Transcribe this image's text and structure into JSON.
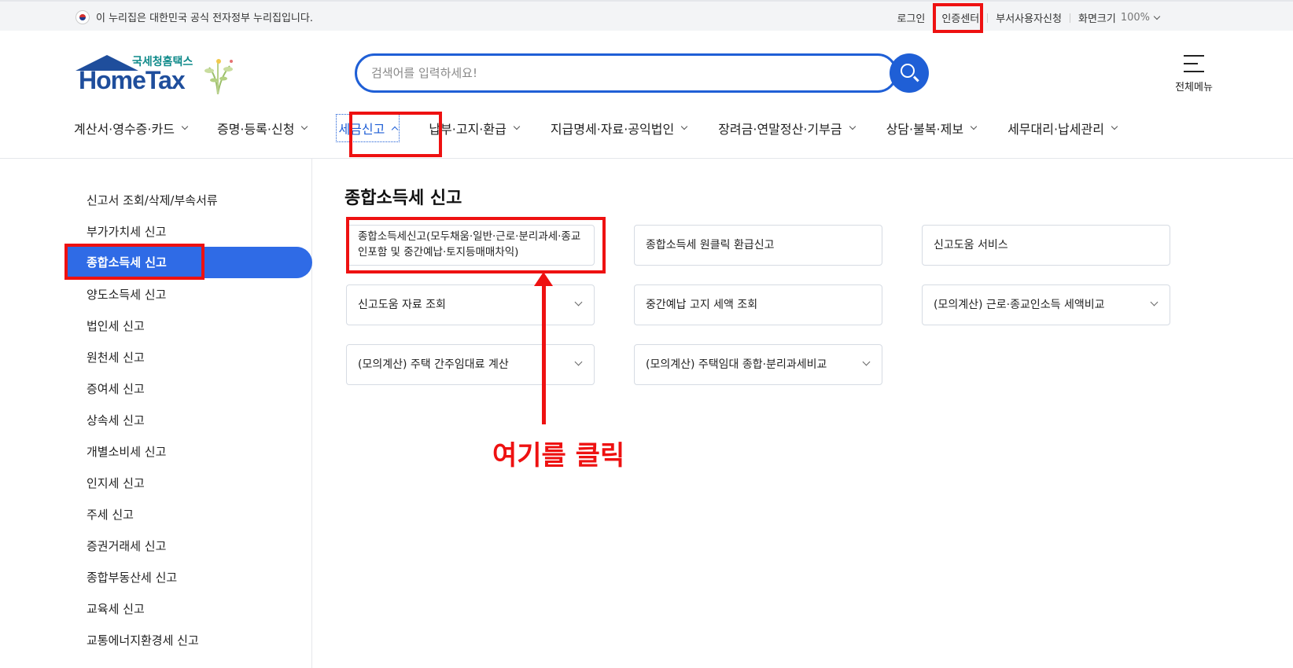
{
  "topbar": {
    "gov_notice": "이 누리집은 대한민국 공식 전자정부 누리집입니다.",
    "login": "로그인",
    "cert_center": "인증센터",
    "dept_user": "부서사용자신청",
    "zoom_label": "화면크기",
    "zoom_value": "100%"
  },
  "header": {
    "logo_kr": "국세청홈택스",
    "logo_en": "HomeTax",
    "search_placeholder": "검색어를 입력하세요!",
    "all_menu": "전체메뉴"
  },
  "gnb": [
    {
      "label": "계산서·영수증·카드"
    },
    {
      "label": "증명·등록·신청"
    },
    {
      "label": "세금신고"
    },
    {
      "label": "납부·고지·환급"
    },
    {
      "label": "지급명세·자료·공익법인"
    },
    {
      "label": "장려금·연말정산·기부금"
    },
    {
      "label": "상담·불복·제보"
    },
    {
      "label": "세무대리·납세관리"
    }
  ],
  "sidebar": [
    {
      "label": "신고서 조회/삭제/부속서류"
    },
    {
      "label": "부가가치세 신고"
    },
    {
      "label": "종합소득세 신고"
    },
    {
      "label": "양도소득세 신고"
    },
    {
      "label": "법인세 신고"
    },
    {
      "label": "원천세 신고"
    },
    {
      "label": "증여세 신고"
    },
    {
      "label": "상속세 신고"
    },
    {
      "label": "개별소비세 신고"
    },
    {
      "label": "인지세 신고"
    },
    {
      "label": "주세 신고"
    },
    {
      "label": "증권거래세 신고"
    },
    {
      "label": "종합부동산세 신고"
    },
    {
      "label": "교육세 신고"
    },
    {
      "label": "교통에너지환경세 신고"
    }
  ],
  "main": {
    "title": "종합소득세 신고",
    "cards": [
      {
        "label": "종합소득세신고(모두채움·일반·근로·분리과세·종교인포함 및 중간예납·토지등매매차익)"
      },
      {
        "label": "종합소득세 원클릭 환급신고"
      },
      {
        "label": "신고도움 서비스"
      },
      {
        "label": "신고도움 자료 조회"
      },
      {
        "label": "중간예납 고지 세액 조회"
      },
      {
        "label": "(모의계산) 근로·종교인소득 세액비교"
      },
      {
        "label": "(모의계산) 주택 간주임대료 계산"
      },
      {
        "label": "(모의계산) 주택임대 종합·분리과세비교"
      }
    ]
  },
  "annotation": {
    "note": "여기를 클릭",
    "color": "#ee1111"
  }
}
